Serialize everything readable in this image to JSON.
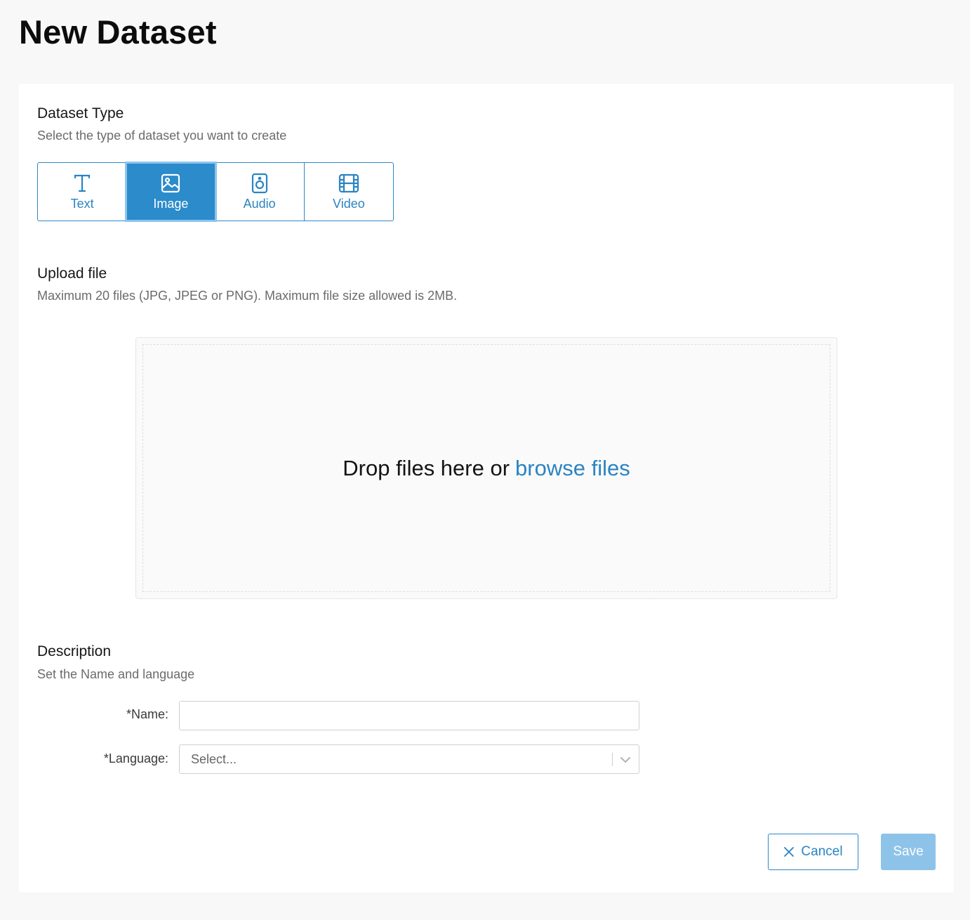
{
  "page": {
    "title": "New Dataset"
  },
  "dataset_type": {
    "title": "Dataset Type",
    "subtitle": "Select the type of dataset you want to create",
    "options": [
      {
        "label": "Text",
        "icon": "text-icon",
        "selected": false
      },
      {
        "label": "Image",
        "icon": "image-icon",
        "selected": true
      },
      {
        "label": "Audio",
        "icon": "audio-icon",
        "selected": false
      },
      {
        "label": "Video",
        "icon": "video-icon",
        "selected": false
      }
    ]
  },
  "upload": {
    "title": "Upload file",
    "subtitle": "Maximum 20 files (JPG, JPEG or PNG). Maximum file size allowed is 2MB.",
    "drop_text": "Drop files here or",
    "browse_label": "browse files"
  },
  "description": {
    "title": "Description",
    "subtitle": "Set the Name and language",
    "name_label": "*Name:",
    "name_value": "",
    "language_label": "*Language:",
    "language_placeholder": "Select..."
  },
  "actions": {
    "cancel_label": "Cancel",
    "save_label": "Save"
  },
  "colors": {
    "accent": "#2b8bcb",
    "save_disabled": "#8ec3e9",
    "background": "#f8f8f8"
  }
}
